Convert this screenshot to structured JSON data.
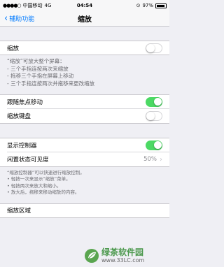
{
  "status": {
    "carrier": "中国移动",
    "network": "4G",
    "time": "04:54",
    "battery": "97%"
  },
  "nav": {
    "back_label": "辅助功能",
    "title": "缩放"
  },
  "zoom_row": {
    "label": "缩放",
    "on": false
  },
  "zoom_footer": {
    "heading": "“缩放”可放大整个屏幕：",
    "lines": [
      "- 三个手指连按两次来缩放",
      "- 拖移三个手指在屏幕上移动",
      "- 三个手指连按两次并拖移来更改缩放"
    ]
  },
  "follow_focus": {
    "label": "跟随焦点移动",
    "on": true
  },
  "zoom_keyboard": {
    "label": "缩放键盘",
    "on": false
  },
  "show_controller": {
    "label": "显示控制器",
    "on": true
  },
  "idle_visibility": {
    "label": "闲置状态可见度",
    "value": "50%"
  },
  "controller_footer": {
    "lines": [
      "“缩放控制器”可以快速进行缩放控制。",
      "• 轻按一次来显示“缩放”菜单。",
      "• 轻按两次来放大和缩小。",
      "• 放大后，拖移来移动缩放的内容。"
    ]
  },
  "zoom_region": {
    "label": "缩放区域"
  },
  "watermark": {
    "brand": "绿茶软件园",
    "url": "www.33LC.com"
  }
}
